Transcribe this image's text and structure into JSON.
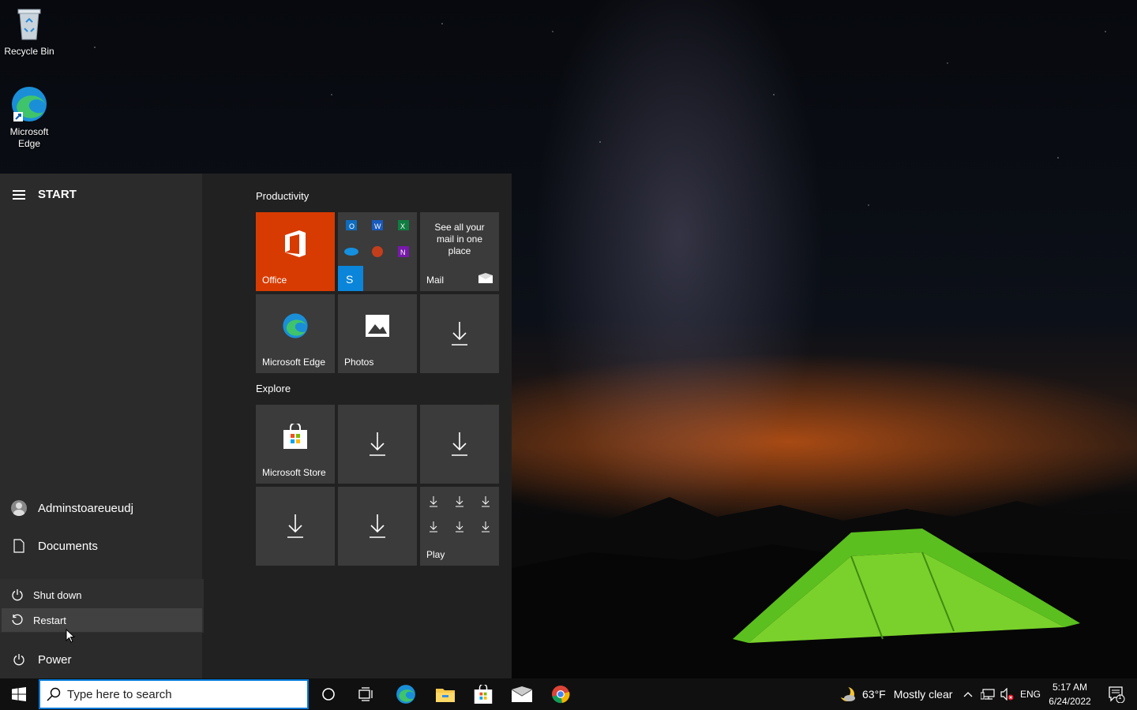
{
  "desktop": {
    "icons": [
      {
        "label": "Recycle Bin"
      },
      {
        "label": "Microsoft\nEdge"
      }
    ]
  },
  "start": {
    "title": "START",
    "user_label": "Adminstoareueudj",
    "documents_label": "Documents",
    "power_label": "Power",
    "power_menu": {
      "shutdown_label": "Shut down",
      "restart_label": "Restart"
    },
    "groups": {
      "productivity": {
        "label": "Productivity",
        "office_label": "Office",
        "mail_label": "Mail",
        "mail_text": "See all your mail in one place",
        "edge_label": "Microsoft Edge",
        "photos_label": "Photos"
      },
      "explore": {
        "label": "Explore",
        "store_label": "Microsoft Store",
        "play_label": "Play"
      }
    }
  },
  "taskbar": {
    "search_placeholder": "Type here to search",
    "weather_temp": "63°F",
    "weather_desc": "Mostly clear",
    "language": "ENG",
    "time": "5:17 AM",
    "date": "6/24/2022",
    "notifications_count": "1"
  },
  "colors": {
    "office": "#d83b01",
    "tile": "#3b3b3b",
    "accent": "#0078d7"
  }
}
